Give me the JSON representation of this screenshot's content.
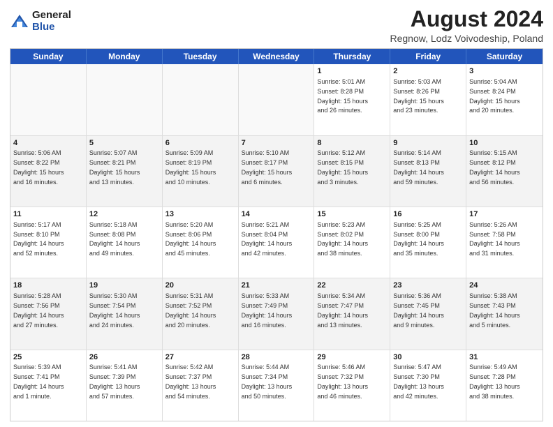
{
  "logo": {
    "general": "General",
    "blue": "Blue"
  },
  "title": "August 2024",
  "subtitle": "Regnow, Lodz Voivodeship, Poland",
  "calendar": {
    "headers": [
      "Sunday",
      "Monday",
      "Tuesday",
      "Wednesday",
      "Thursday",
      "Friday",
      "Saturday"
    ],
    "weeks": [
      [
        {
          "day": "",
          "text": ""
        },
        {
          "day": "",
          "text": ""
        },
        {
          "day": "",
          "text": ""
        },
        {
          "day": "",
          "text": ""
        },
        {
          "day": "1",
          "text": "Sunrise: 5:01 AM\nSunset: 8:28 PM\nDaylight: 15 hours\nand 26 minutes."
        },
        {
          "day": "2",
          "text": "Sunrise: 5:03 AM\nSunset: 8:26 PM\nDaylight: 15 hours\nand 23 minutes."
        },
        {
          "day": "3",
          "text": "Sunrise: 5:04 AM\nSunset: 8:24 PM\nDaylight: 15 hours\nand 20 minutes."
        }
      ],
      [
        {
          "day": "4",
          "text": "Sunrise: 5:06 AM\nSunset: 8:22 PM\nDaylight: 15 hours\nand 16 minutes."
        },
        {
          "day": "5",
          "text": "Sunrise: 5:07 AM\nSunset: 8:21 PM\nDaylight: 15 hours\nand 13 minutes."
        },
        {
          "day": "6",
          "text": "Sunrise: 5:09 AM\nSunset: 8:19 PM\nDaylight: 15 hours\nand 10 minutes."
        },
        {
          "day": "7",
          "text": "Sunrise: 5:10 AM\nSunset: 8:17 PM\nDaylight: 15 hours\nand 6 minutes."
        },
        {
          "day": "8",
          "text": "Sunrise: 5:12 AM\nSunset: 8:15 PM\nDaylight: 15 hours\nand 3 minutes."
        },
        {
          "day": "9",
          "text": "Sunrise: 5:14 AM\nSunset: 8:13 PM\nDaylight: 14 hours\nand 59 minutes."
        },
        {
          "day": "10",
          "text": "Sunrise: 5:15 AM\nSunset: 8:12 PM\nDaylight: 14 hours\nand 56 minutes."
        }
      ],
      [
        {
          "day": "11",
          "text": "Sunrise: 5:17 AM\nSunset: 8:10 PM\nDaylight: 14 hours\nand 52 minutes."
        },
        {
          "day": "12",
          "text": "Sunrise: 5:18 AM\nSunset: 8:08 PM\nDaylight: 14 hours\nand 49 minutes."
        },
        {
          "day": "13",
          "text": "Sunrise: 5:20 AM\nSunset: 8:06 PM\nDaylight: 14 hours\nand 45 minutes."
        },
        {
          "day": "14",
          "text": "Sunrise: 5:21 AM\nSunset: 8:04 PM\nDaylight: 14 hours\nand 42 minutes."
        },
        {
          "day": "15",
          "text": "Sunrise: 5:23 AM\nSunset: 8:02 PM\nDaylight: 14 hours\nand 38 minutes."
        },
        {
          "day": "16",
          "text": "Sunrise: 5:25 AM\nSunset: 8:00 PM\nDaylight: 14 hours\nand 35 minutes."
        },
        {
          "day": "17",
          "text": "Sunrise: 5:26 AM\nSunset: 7:58 PM\nDaylight: 14 hours\nand 31 minutes."
        }
      ],
      [
        {
          "day": "18",
          "text": "Sunrise: 5:28 AM\nSunset: 7:56 PM\nDaylight: 14 hours\nand 27 minutes."
        },
        {
          "day": "19",
          "text": "Sunrise: 5:30 AM\nSunset: 7:54 PM\nDaylight: 14 hours\nand 24 minutes."
        },
        {
          "day": "20",
          "text": "Sunrise: 5:31 AM\nSunset: 7:52 PM\nDaylight: 14 hours\nand 20 minutes."
        },
        {
          "day": "21",
          "text": "Sunrise: 5:33 AM\nSunset: 7:49 PM\nDaylight: 14 hours\nand 16 minutes."
        },
        {
          "day": "22",
          "text": "Sunrise: 5:34 AM\nSunset: 7:47 PM\nDaylight: 14 hours\nand 13 minutes."
        },
        {
          "day": "23",
          "text": "Sunrise: 5:36 AM\nSunset: 7:45 PM\nDaylight: 14 hours\nand 9 minutes."
        },
        {
          "day": "24",
          "text": "Sunrise: 5:38 AM\nSunset: 7:43 PM\nDaylight: 14 hours\nand 5 minutes."
        }
      ],
      [
        {
          "day": "25",
          "text": "Sunrise: 5:39 AM\nSunset: 7:41 PM\nDaylight: 14 hours\nand 1 minute."
        },
        {
          "day": "26",
          "text": "Sunrise: 5:41 AM\nSunset: 7:39 PM\nDaylight: 13 hours\nand 57 minutes."
        },
        {
          "day": "27",
          "text": "Sunrise: 5:42 AM\nSunset: 7:37 PM\nDaylight: 13 hours\nand 54 minutes."
        },
        {
          "day": "28",
          "text": "Sunrise: 5:44 AM\nSunset: 7:34 PM\nDaylight: 13 hours\nand 50 minutes."
        },
        {
          "day": "29",
          "text": "Sunrise: 5:46 AM\nSunset: 7:32 PM\nDaylight: 13 hours\nand 46 minutes."
        },
        {
          "day": "30",
          "text": "Sunrise: 5:47 AM\nSunset: 7:30 PM\nDaylight: 13 hours\nand 42 minutes."
        },
        {
          "day": "31",
          "text": "Sunrise: 5:49 AM\nSunset: 7:28 PM\nDaylight: 13 hours\nand 38 minutes."
        }
      ]
    ]
  }
}
